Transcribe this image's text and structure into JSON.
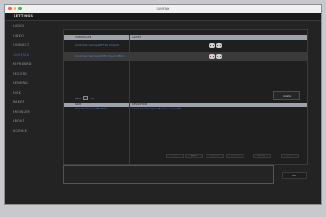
{
  "window": {
    "title": "GAMENIX",
    "traffic_lights": {
      "close": "#ff5f57",
      "minimize": "#febc2e",
      "zoom": "#28c840"
    }
  },
  "header": {
    "title": "SETTINGS"
  },
  "sidebar": {
    "items": [
      {
        "label": "AUDIO"
      },
      {
        "label": "VIDEO"
      },
      {
        "label": "CONNECT"
      },
      {
        "label": "GAMEPAD",
        "active": true
      },
      {
        "label": "KEYBOARD"
      },
      {
        "label": "RECORD"
      },
      {
        "label": "GENERAL"
      },
      {
        "label": "DISK"
      },
      {
        "label": "MAKER"
      },
      {
        "label": "BROWSER"
      },
      {
        "label": "ABOUT"
      },
      {
        "label": "LICENSE"
      }
    ],
    "accent": "#4a63c6"
  },
  "controllers": {
    "columns": [
      "CONTROLLER",
      "LAYOUT"
    ],
    "rows": [
      {
        "name": "Controller Gamepad F710 (XInput)",
        "icon": "gamepad-icon"
      },
      {
        "name": "Controller Gamepad (MFi XInput XBOX)",
        "icon": "gamepad-icon"
      }
    ]
  },
  "pad_count": {
    "label": "PADS",
    "value": "1/4"
  },
  "delete_button": {
    "label": "Delete",
    "border_color": "#c0182a"
  },
  "mappings": {
    "columns": [
      "NAME",
      "DESCRIPTION"
    ],
    "rows": [
      {
        "name": "Default Gamepad (MFi XBOX)",
        "description": "Gamepad mapping for MFi XInput / Apple MFi"
      }
    ]
  },
  "action_buttons": [
    {
      "label": "Load",
      "state": "dim"
    },
    {
      "label": "Save",
      "state": "on"
    },
    {
      "label": "Duplicate",
      "state": "dim"
    },
    {
      "label": "Rename",
      "state": "dim"
    },
    {
      "label": "Record",
      "state": "hl"
    },
    {
      "label": "Delete",
      "state": "dim"
    }
  ],
  "ok_button": {
    "label": "OK"
  }
}
